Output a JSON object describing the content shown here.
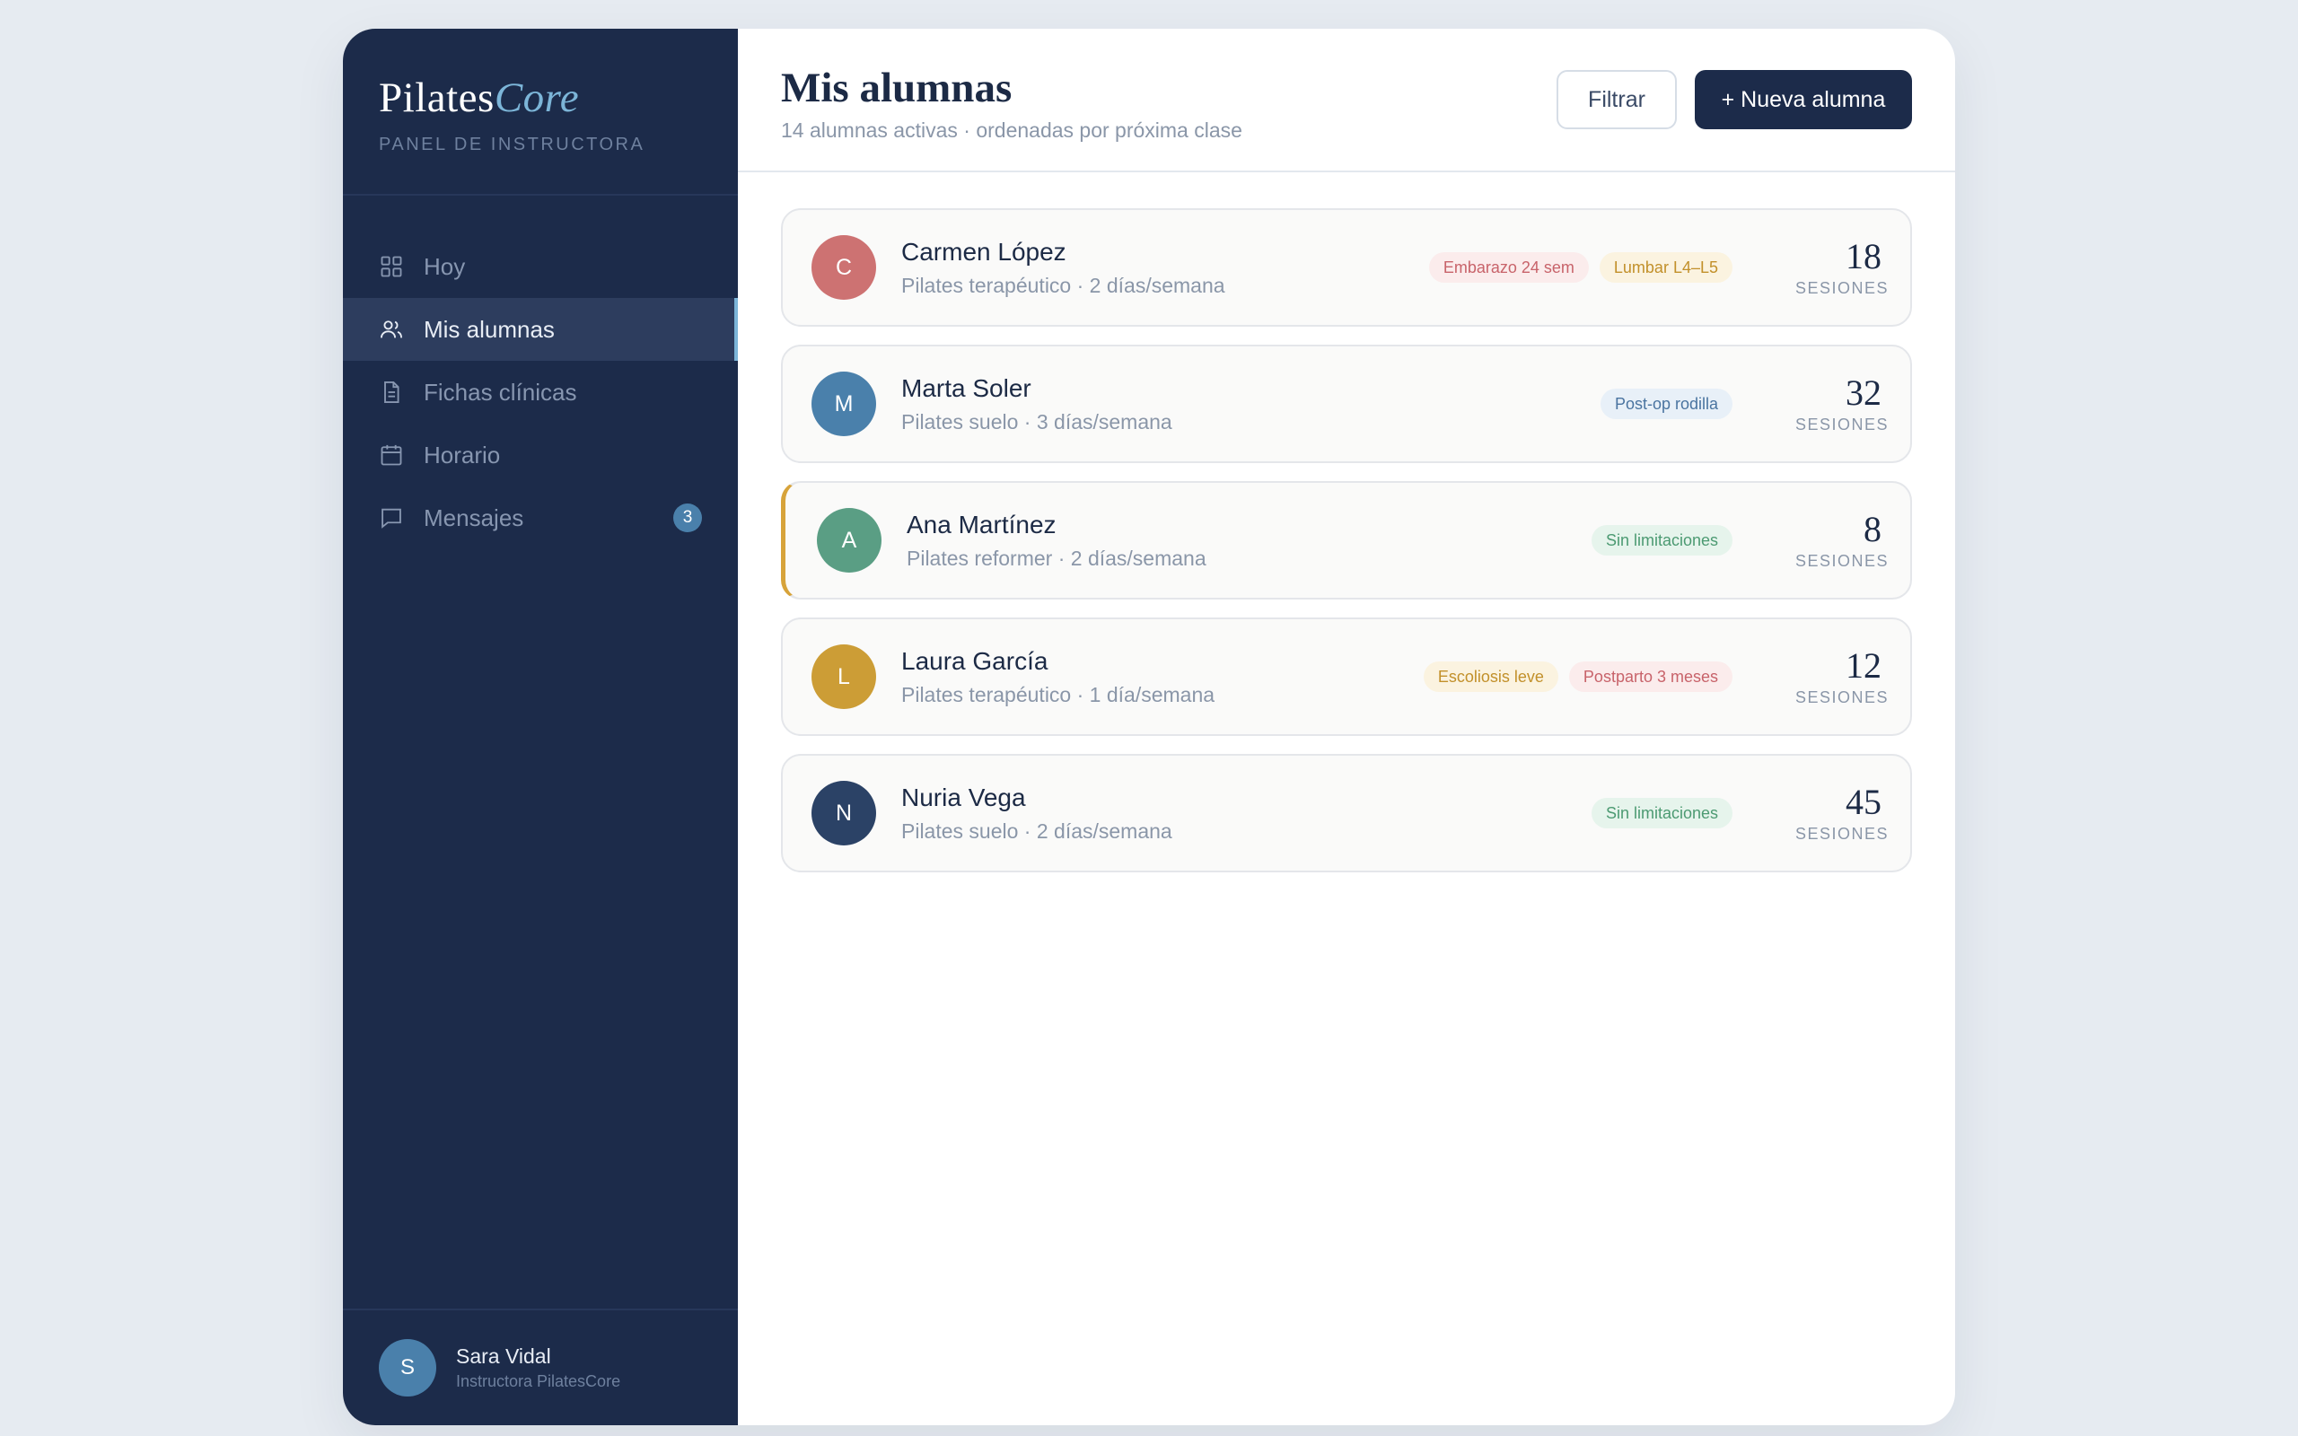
{
  "brand": {
    "name_main": "Pilates",
    "name_accent": "Core",
    "subtitle": "PANEL DE INSTRUCTORA"
  },
  "nav": [
    {
      "label": "Hoy",
      "icon": "grid-icon",
      "active": false
    },
    {
      "label": "Mis alumnas",
      "icon": "users-icon",
      "active": true
    },
    {
      "label": "Fichas clínicas",
      "icon": "document-icon",
      "active": false
    },
    {
      "label": "Horario",
      "icon": "calendar-icon",
      "active": false
    },
    {
      "label": "Mensajes",
      "icon": "message-icon",
      "active": false,
      "badge": "3"
    }
  ],
  "user": {
    "initial": "S",
    "name": "Sara Vidal",
    "role": "Instructora PilatesCore"
  },
  "header": {
    "title": "Mis alumnas",
    "subtitle": "14 alumnas activas · ordenadas por próxima clase",
    "filter_label": "Filtrar",
    "new_label": "+ Nueva alumna"
  },
  "sessions_label": "SESIONES",
  "students": [
    {
      "initial": "C",
      "name": "Carmen López",
      "meta": "Pilates terapéutico · 2 días/semana",
      "avatar_color": "#cd7272",
      "tags": [
        {
          "text": "Embarazo 24 sem",
          "tone": "red"
        },
        {
          "text": "Lumbar L4–L5",
          "tone": "amber"
        }
      ],
      "sessions": "18",
      "highlight": false
    },
    {
      "initial": "M",
      "name": "Marta Soler",
      "meta": "Pilates suelo · 3 días/semana",
      "avatar_color": "#4a80ab",
      "tags": [
        {
          "text": "Post-op rodilla",
          "tone": "blue"
        }
      ],
      "sessions": "32",
      "highlight": false
    },
    {
      "initial": "A",
      "name": "Ana Martínez",
      "meta": "Pilates reformer · 2 días/semana",
      "avatar_color": "#5a9e84",
      "tags": [
        {
          "text": "Sin limitaciones",
          "tone": "green"
        }
      ],
      "sessions": "8",
      "highlight": true
    },
    {
      "initial": "L",
      "name": "Laura García",
      "meta": "Pilates terapéutico · 1 día/semana",
      "avatar_color": "#cc9d36",
      "tags": [
        {
          "text": "Escoliosis leve",
          "tone": "amber"
        },
        {
          "text": "Postparto 3 meses",
          "tone": "red"
        }
      ],
      "sessions": "12",
      "highlight": false
    },
    {
      "initial": "N",
      "name": "Nuria Vega",
      "meta": "Pilates suelo · 2 días/semana",
      "avatar_color": "#2b4266",
      "tags": [
        {
          "text": "Sin limitaciones",
          "tone": "green"
        }
      ],
      "sessions": "45",
      "highlight": false
    }
  ]
}
